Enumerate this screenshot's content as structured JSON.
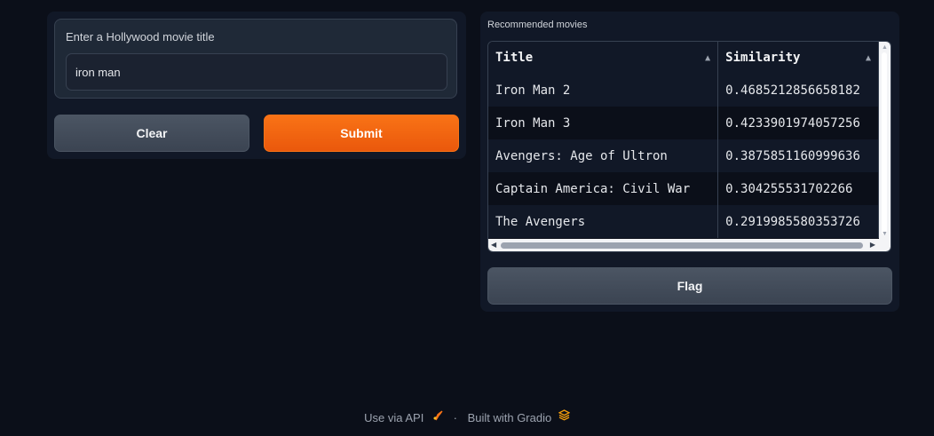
{
  "input": {
    "label": "Enter a Hollywood movie title",
    "value": "iron man"
  },
  "buttons": {
    "clear": "Clear",
    "submit": "Submit",
    "flag": "Flag"
  },
  "output": {
    "label": "Recommended movies",
    "columns": [
      "Title",
      "Similarity"
    ],
    "rows": [
      [
        "Iron Man 2",
        "0.4685212856658182"
      ],
      [
        "Iron Man 3",
        "0.4233901974057256"
      ],
      [
        "Avengers: Age of Ultron",
        "0.3875851160999636"
      ],
      [
        "Captain America: Civil War",
        "0.304255531702266"
      ],
      [
        "The Avengers",
        "0.2919985580353726"
      ]
    ]
  },
  "footer": {
    "api_link": "Use via API",
    "separator": "·",
    "built_with": "Built with Gradio"
  },
  "icons": {
    "sort": "sort-ascending-icon",
    "api": "rocket-icon",
    "gradio": "gradio-logo-icon"
  },
  "colors": {
    "accent": "#f97316",
    "background": "#0b0f19",
    "panel": "#111827"
  }
}
